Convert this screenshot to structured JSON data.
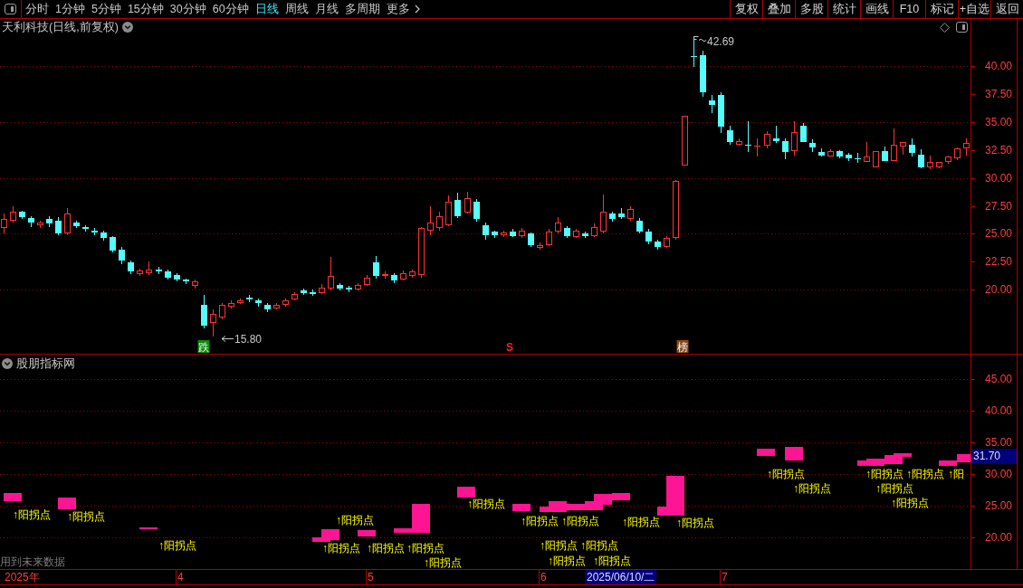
{
  "toolbar": {
    "periods": [
      {
        "label": "分时",
        "selected": false
      },
      {
        "label": "1分钟",
        "selected": false
      },
      {
        "label": "5分钟",
        "selected": false
      },
      {
        "label": "15分钟",
        "selected": false
      },
      {
        "label": "30分钟",
        "selected": false
      },
      {
        "label": "60分钟",
        "selected": false
      },
      {
        "label": "日线",
        "selected": true
      },
      {
        "label": "周线",
        "selected": false
      },
      {
        "label": "月线",
        "selected": false
      },
      {
        "label": "多周期",
        "selected": false
      }
    ],
    "more": "更多",
    "actions": [
      "复权",
      "叠加",
      "多股",
      "统计",
      "画线",
      "F10",
      "标记",
      "+自选",
      "返回"
    ]
  },
  "price_pane": {
    "title": "天利科技(日线,前复权)",
    "axis_labels": [
      "40.00",
      "37.50",
      "35.00",
      "32.50",
      "30.00",
      "27.50",
      "25.00",
      "22.50",
      "20.00"
    ],
    "high_label": "42.69",
    "low_label": "15.80",
    "markers": [
      {
        "kind": "badge",
        "text": "跌",
        "color": "#0a8c0a"
      },
      {
        "kind": "letter",
        "text": "S",
        "color": "#ff2020"
      },
      {
        "kind": "badge",
        "text": "榜",
        "color": "#8a4a1c"
      }
    ]
  },
  "indicator_pane": {
    "title": "股朋指标网",
    "axis_labels": [
      "45.00",
      "40.00",
      "35.00",
      "30.00",
      "25.00",
      "20.00"
    ],
    "cursor_value": "31.70",
    "signals": [
      "↑阳拐点",
      "↑阳拐点",
      "↑阳拐点",
      "↑阳拐点",
      "↑阳拐点",
      "↑阳拐点",
      "↑阳拐点",
      "↑阳拐点",
      "↑阳拐点",
      "↑阳拐点",
      "↑阳拐点",
      "↑阳拐点",
      "↑阳拐点",
      "↑阳拐点",
      "↑阳拐点",
      "↑阳拐点",
      "↑阳拐点",
      "↑阳拐点",
      "↑阳拐点",
      "↑阳拐点",
      "↑阳拐点",
      "↑阳拐点",
      "↑阳拐点",
      "↑阳"
    ],
    "note": "用到未来数据"
  },
  "date_axis": {
    "labels": [
      "2025年",
      "4",
      "5",
      "6",
      "7"
    ],
    "cursor": "2025/06/10/二"
  }
}
